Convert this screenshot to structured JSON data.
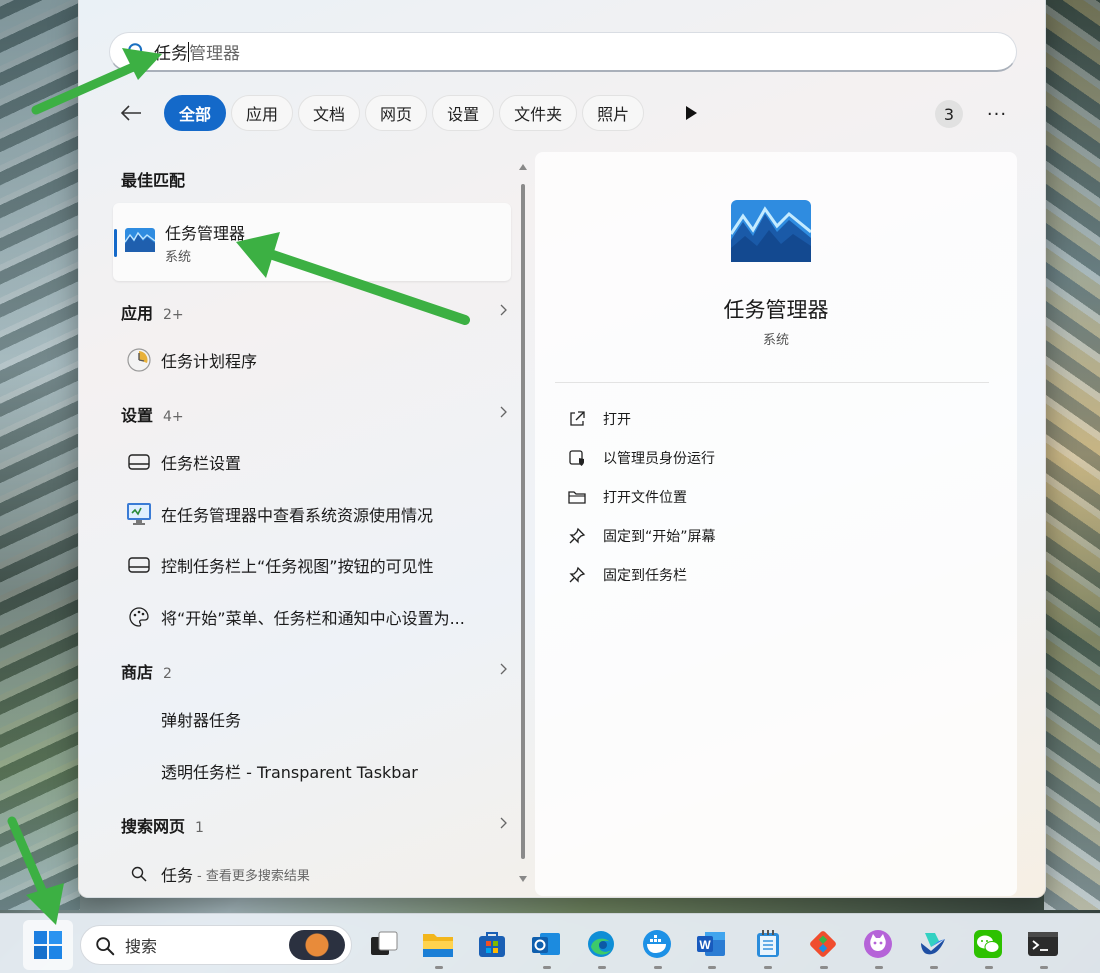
{
  "search": {
    "query_typed": "任务",
    "query_rest": "管理器"
  },
  "filters": {
    "back_label": "←",
    "chips": [
      "全部",
      "应用",
      "文档",
      "网页",
      "设置",
      "文件夹",
      "照片"
    ],
    "active_chip": "全部",
    "count": "3",
    "more": "···"
  },
  "results": {
    "best_match_title": "最佳匹配",
    "best_match": {
      "name": "任务管理器",
      "sub": "系统"
    },
    "apps": {
      "title": "应用",
      "count": "2+",
      "items": [
        "任务计划程序"
      ]
    },
    "settings": {
      "title": "设置",
      "count": "4+",
      "items": [
        "任务栏设置",
        "在任务管理器中查看系统资源使用情况",
        "控制任务栏上“任务视图”按钮的可见性",
        "将“开始”菜单、任务栏和通知中心设置为..."
      ]
    },
    "store": {
      "title": "商店",
      "count": "2",
      "items": [
        "弹射器任务",
        "透明任务栏 - Transparent Taskbar"
      ]
    },
    "web": {
      "title": "搜索网页",
      "count": "1",
      "query": "任务",
      "sub": "- 查看更多搜索结果"
    }
  },
  "preview": {
    "title": "任务管理器",
    "subtitle": "系统",
    "actions": [
      "打开",
      "以管理员身份运行",
      "打开文件位置",
      "固定到“开始”屏幕",
      "固定到任务栏"
    ]
  },
  "taskbar": {
    "search_label": "搜索",
    "apps": [
      "task-view",
      "file-explorer",
      "microsoft-store",
      "outlook",
      "edge",
      "docker",
      "word",
      "notepad",
      "git",
      "cat-app",
      "feishu",
      "wechat",
      "terminal"
    ]
  },
  "colors": {
    "accent": "#1469c9",
    "arrow": "#3cb043"
  }
}
